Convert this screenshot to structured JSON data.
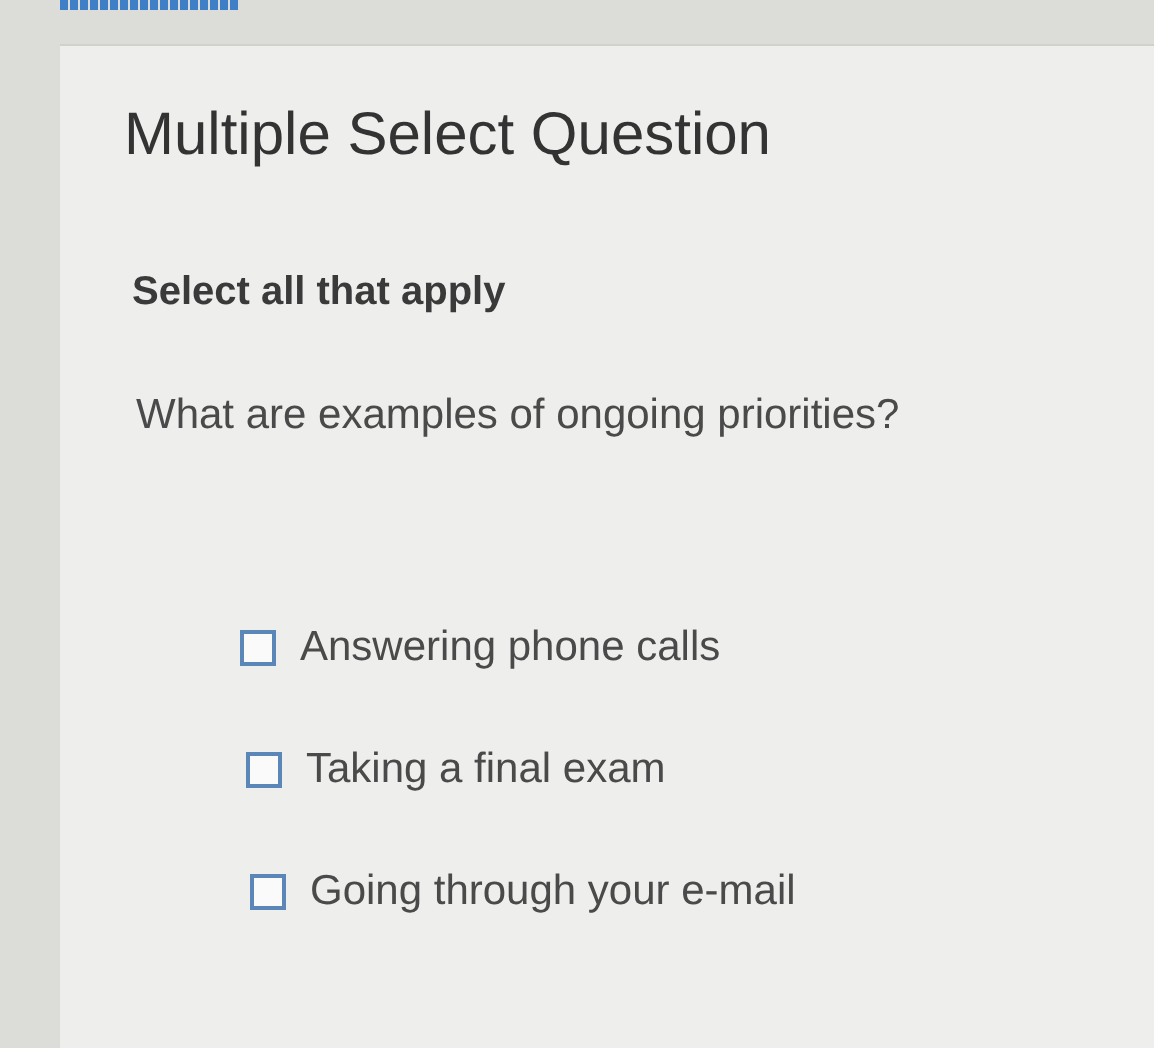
{
  "heading": "Multiple Select Question",
  "instruction": "Select all that apply",
  "question": "What are examples of ongoing priorities?",
  "options": [
    {
      "label": "Answering phone calls",
      "checked": false
    },
    {
      "label": "Taking a final exam",
      "checked": false
    },
    {
      "label": "Going through your e-mail",
      "checked": false
    }
  ]
}
